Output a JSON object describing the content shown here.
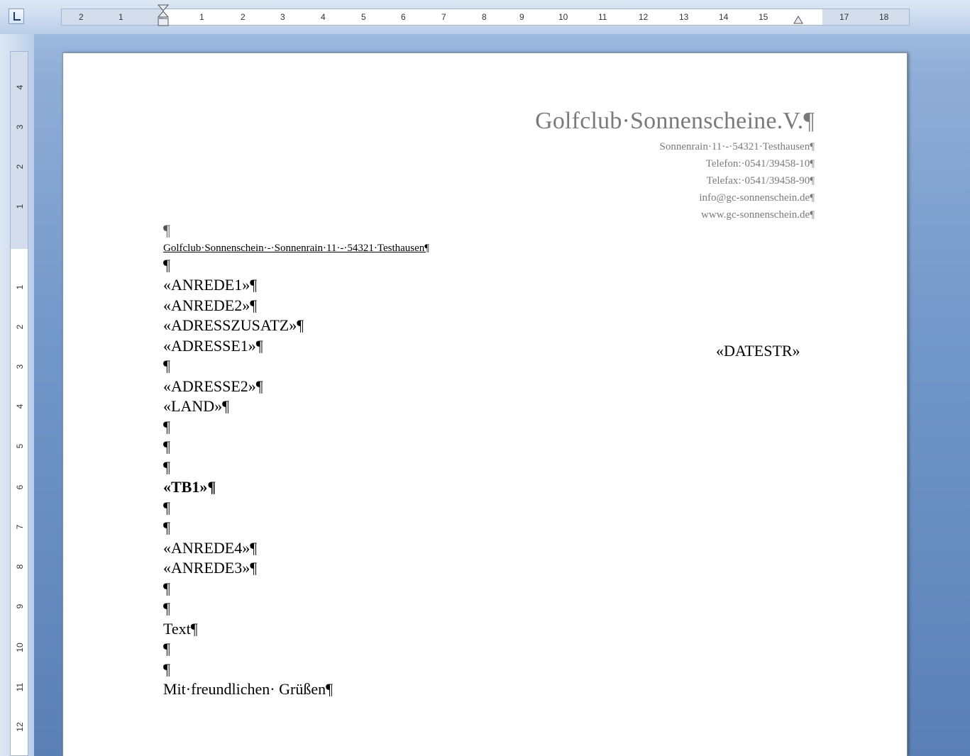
{
  "ruler": {
    "horizontal_numbers": [
      "2",
      "1",
      "1",
      "2",
      "3",
      "4",
      "5",
      "6",
      "7",
      "8",
      "9",
      "10",
      "11",
      "12",
      "13",
      "14",
      "15",
      "17",
      "18"
    ],
    "vertical_numbers": [
      "4",
      "3",
      "2",
      "1",
      "1",
      "2",
      "3",
      "4",
      "5",
      "6",
      "7",
      "8",
      "9",
      "10",
      "11",
      "12"
    ]
  },
  "header": {
    "org_name": "Golfclub·Sonnenscheine.V.¶",
    "address": "Sonnenrain·11·-·54321·Testhausen¶",
    "phone": "Telefon:·0541/39458-10¶",
    "fax": "Telefax:·0541/39458-90¶",
    "email": "info@gc-sonnenschein.de¶",
    "website": "www.gc-sonnenschein.de¶"
  },
  "letter": {
    "blank_top": "¶",
    "sender_line": "Golfclub·Sonnenschein·-·Sonnenrain·11·-·54321·Testhausen¶",
    "blank1": "¶",
    "anrede1": "«ANREDE1»¶",
    "anrede2": "«ANREDE2»¶",
    "adresszusatz": "«ADRESSZUSATZ»¶",
    "adresse1": "«ADRESSE1»¶",
    "blank2": "¶",
    "adresse2": "«ADRESSE2»¶",
    "land": "«LAND»¶",
    "blank3": "¶",
    "blank4": "¶",
    "blank5": "¶",
    "tb1": "«TB1»¶",
    "blank6": "¶",
    "blank7": "¶",
    "anrede4": "«ANREDE4»¶",
    "anrede3": "«ANREDE3»¶",
    "blank8": "¶",
    "blank9": "¶",
    "text": "Text¶",
    "blank10": "¶",
    "blank11": "¶",
    "closing": "Mit·freundlichen· Grüßen¶"
  },
  "date_field": "«DATESTR»"
}
